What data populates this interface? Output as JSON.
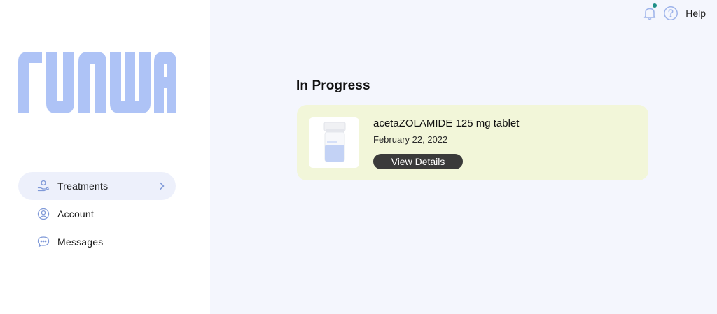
{
  "brand": {
    "logo_text": "RUNWAY",
    "logo_color": "#aec3f6"
  },
  "sidebar": {
    "items": [
      {
        "label": "Treatments",
        "icon": "hand-pill-icon",
        "active": true
      },
      {
        "label": "Account",
        "icon": "user-circle-icon",
        "active": false
      },
      {
        "label": "Messages",
        "icon": "chat-bubble-icon",
        "active": false
      }
    ]
  },
  "topbar": {
    "notification_icon": "bell-icon",
    "help_icon": "question-circle-icon",
    "help_label": "Help"
  },
  "main": {
    "section_title": "In Progress",
    "treatments": [
      {
        "name": "acetaZOLAMIDE 125 mg tablet",
        "date": "February 22, 2022",
        "action_label": "View Details",
        "image_icon": "pill-bottle-icon"
      }
    ]
  },
  "colors": {
    "accent": "#aec3f6",
    "card_background": "#f2f6d9",
    "button": "#3a3a3a",
    "notification_dot": "#1f8f87"
  }
}
